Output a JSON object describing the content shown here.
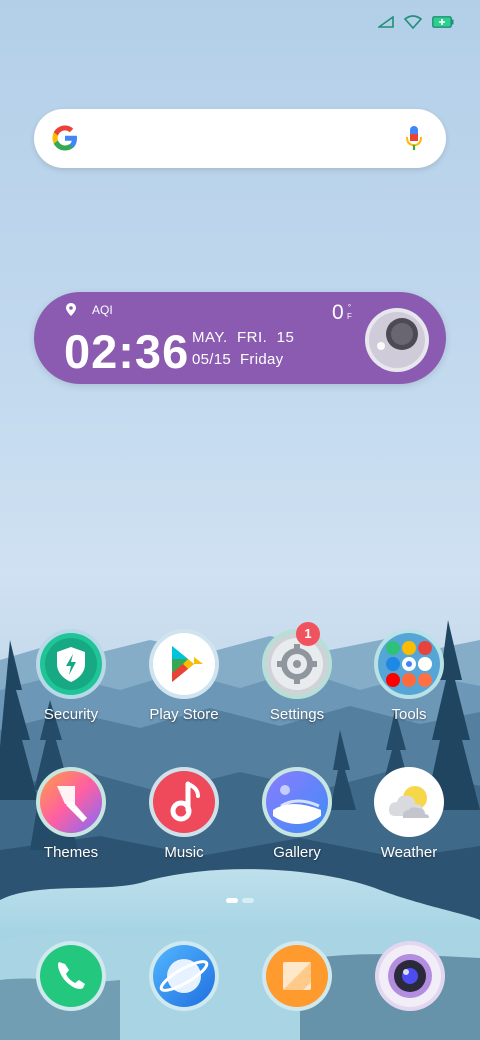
{
  "status_bar": {
    "icons": [
      "cellular-signal-icon",
      "wifi-icon",
      "battery-charging-icon"
    ]
  },
  "search": {
    "placeholder": "",
    "icons": [
      "google-logo-icon",
      "microphone-icon"
    ]
  },
  "clock_widget": {
    "location_label": "AQI",
    "time": "02:36",
    "date_line1": "MAY.  FRI.  15",
    "date_line2": "05/15  Friday",
    "temperature": "0",
    "temp_unit_top": "°",
    "temp_unit_bottom": "F",
    "weather_icon": "weather-lens-icon",
    "color": "#8a5bb0"
  },
  "apps": [
    {
      "label": "Security",
      "icon": "security-shield-icon"
    },
    {
      "label": "Play Store",
      "icon": "play-store-icon"
    },
    {
      "label": "Settings",
      "icon": "settings-gear-icon",
      "badge": "1"
    },
    {
      "label": "Tools",
      "icon": "tools-folder-icon"
    },
    {
      "label": "Themes",
      "icon": "themes-brush-icon"
    },
    {
      "label": "Music",
      "icon": "music-note-icon"
    },
    {
      "label": "Gallery",
      "icon": "gallery-icon"
    },
    {
      "label": "Weather",
      "icon": "weather-cloud-sun-icon"
    }
  ],
  "pager": {
    "pages": 2,
    "current": 1
  },
  "dock": [
    {
      "icon": "phone-icon"
    },
    {
      "icon": "browser-icon"
    },
    {
      "icon": "notes-icon"
    },
    {
      "icon": "camera-icon"
    }
  ],
  "colors": {
    "badge": "#f0525e",
    "label_text": "#ffffff"
  }
}
